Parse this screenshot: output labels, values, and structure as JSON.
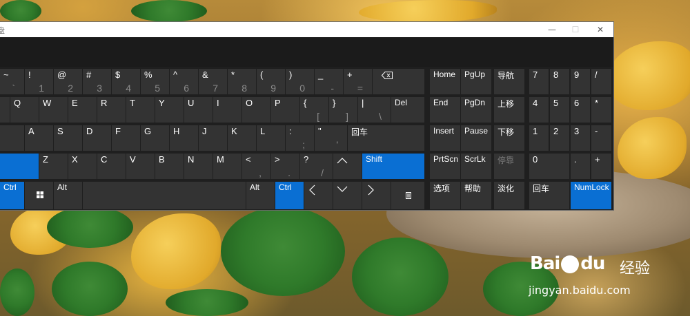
{
  "window": {
    "title": "盘"
  },
  "titlebar_buttons": {
    "minimize": "—",
    "maximize": "☐",
    "close": "✕"
  },
  "keyboard": {
    "row1": [
      {
        "pri": "~",
        "alt": "`"
      },
      {
        "pri": "!",
        "alt": "1"
      },
      {
        "pri": "@",
        "alt": "2"
      },
      {
        "pri": "#",
        "alt": "3"
      },
      {
        "pri": "$",
        "alt": "4"
      },
      {
        "pri": "%",
        "alt": "5"
      },
      {
        "pri": "^",
        "alt": "6"
      },
      {
        "pri": "&",
        "alt": "7"
      },
      {
        "pri": "*",
        "alt": "8"
      },
      {
        "pri": "(",
        "alt": "9"
      },
      {
        "pri": ")",
        "alt": "0"
      },
      {
        "pri": "_",
        "alt": "-"
      },
      {
        "pri": "+",
        "alt": "="
      }
    ],
    "row2": [
      {
        "pri": "Q"
      },
      {
        "pri": "W"
      },
      {
        "pri": "E"
      },
      {
        "pri": "R"
      },
      {
        "pri": "T"
      },
      {
        "pri": "Y"
      },
      {
        "pri": "U"
      },
      {
        "pri": "I"
      },
      {
        "pri": "O"
      },
      {
        "pri": "P"
      },
      {
        "pri": "{",
        "alt": "["
      },
      {
        "pri": "}",
        "alt": "]"
      },
      {
        "pri": "|",
        "alt": "\\"
      },
      {
        "pri": "Del"
      }
    ],
    "row3": [
      {
        "pri": "A"
      },
      {
        "pri": "S"
      },
      {
        "pri": "D"
      },
      {
        "pri": "F"
      },
      {
        "pri": "G"
      },
      {
        "pri": "H"
      },
      {
        "pri": "J"
      },
      {
        "pri": "K"
      },
      {
        "pri": "L"
      },
      {
        "pri": ":",
        "alt": ";"
      },
      {
        "pri": "\"",
        "alt": "'"
      },
      {
        "pri": "回车"
      }
    ],
    "row4": [
      {
        "pri": "Z"
      },
      {
        "pri": "X"
      },
      {
        "pri": "C"
      },
      {
        "pri": "V"
      },
      {
        "pri": "B"
      },
      {
        "pri": "N"
      },
      {
        "pri": "M"
      },
      {
        "pri": "<",
        "alt": ","
      },
      {
        "pri": ">",
        "alt": "."
      },
      {
        "pri": "?",
        "alt": "/"
      },
      {
        "pri": "Shift"
      }
    ],
    "row5": {
      "ctrl_left": "Ctrl",
      "alt_left": "Alt",
      "alt_right": "Alt",
      "ctrl_right": "Ctrl"
    }
  },
  "nav_keys": [
    [
      "Home",
      "PgUp",
      "导航"
    ],
    [
      "End",
      "PgDn",
      "上移"
    ],
    [
      "Insert",
      "Pause",
      "下移"
    ],
    [
      "PrtScn",
      "ScrLk",
      "停靠"
    ],
    [
      "选项",
      "帮助",
      "淡化"
    ]
  ],
  "numpad": [
    [
      "7",
      "8",
      "9",
      "/"
    ],
    [
      "4",
      "5",
      "6",
      "*"
    ],
    [
      "1",
      "2",
      "3",
      "-"
    ],
    [
      "0",
      "",
      ".",
      "+"
    ],
    [
      "回车",
      "",
      "NumLock",
      ""
    ]
  ],
  "colors": {
    "key": "#333333",
    "key_active": "#0a6fd3",
    "panel": "#1f1f1f"
  },
  "watermark": {
    "brand": "Bai",
    "brand2": "du",
    "cn": "经验",
    "url": "jingyan.baidu.com"
  }
}
